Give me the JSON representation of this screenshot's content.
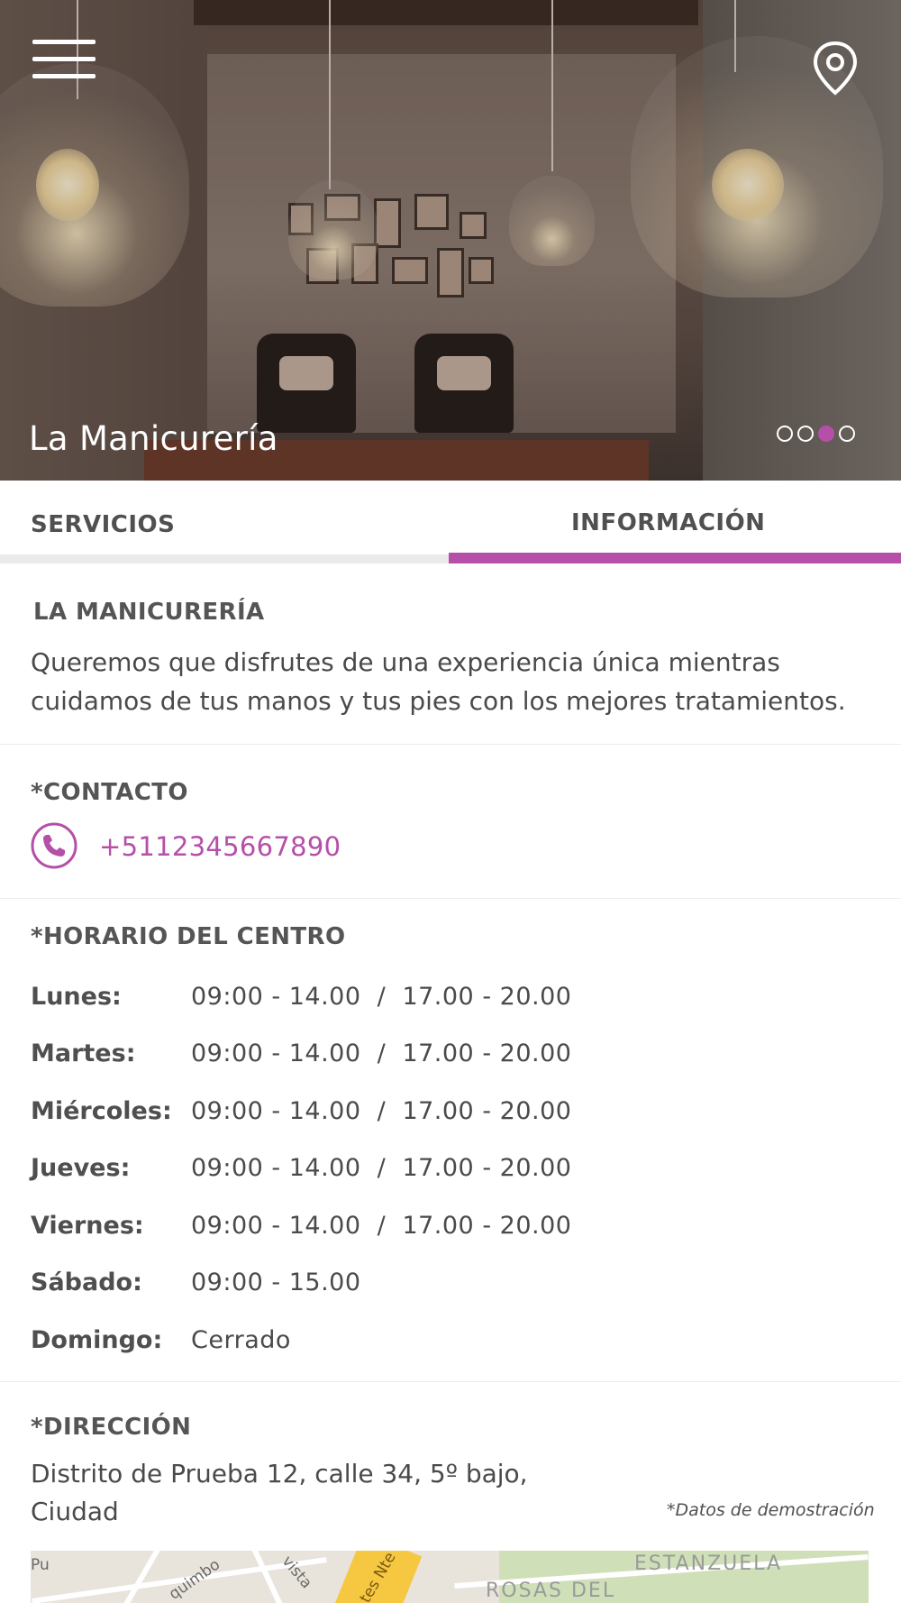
{
  "hero": {
    "title": "La Manicurería",
    "slide_count": 4,
    "active_slide": 3
  },
  "icons": {
    "menu": "hamburger-menu-icon",
    "location": "location-pin-icon",
    "phone": "phone-icon"
  },
  "colors": {
    "accent": "#b54fa8",
    "text": "#4a4a4a",
    "tab_inactive_bar": "#ebebeb"
  },
  "tabs": [
    {
      "label": "SERVICIOS",
      "active": false
    },
    {
      "label": "INFORMACIÓN",
      "active": true
    }
  ],
  "about": {
    "title": "LA MANICURERÍA",
    "text": "Queremos que disfrutes de una experiencia única mientras cuidamos de tus manos y tus pies con los mejores tratamientos."
  },
  "contact": {
    "title": "*CONTACTO",
    "phone": "+5112345667890"
  },
  "hours": {
    "title": "*HORARIO DEL CENTRO",
    "rows": [
      {
        "day": "Lunes:",
        "time": "09:00 - 14.00  /  17.00 - 20.00"
      },
      {
        "day": "Martes:",
        "time": "09:00 - 14.00  /  17.00 - 20.00"
      },
      {
        "day": "Miércoles:",
        "time": "09:00 - 14.00  /  17.00 - 20.00"
      },
      {
        "day": "Jueves:",
        "time": "09:00 - 14.00  /  17.00 - 20.00"
      },
      {
        "day": "Viernes:",
        "time": "09:00 - 14.00  /  17.00 - 20.00"
      },
      {
        "day": "Sábado:",
        "time": "09:00 - 15.00"
      },
      {
        "day": "Domingo:",
        "time": "Cerrado"
      }
    ]
  },
  "address": {
    "title": "*DIRECCIÓN",
    "line1": "Distrito de Prueba 12, calle 34, 5º bajo,",
    "line2": "Ciudad",
    "note": "*Datos de demostración"
  },
  "map": {
    "labels": [
      "Pu",
      "quimbo",
      "vista",
      "tes Nte",
      "ESTANZUELA",
      "ROSAS DEL"
    ]
  }
}
